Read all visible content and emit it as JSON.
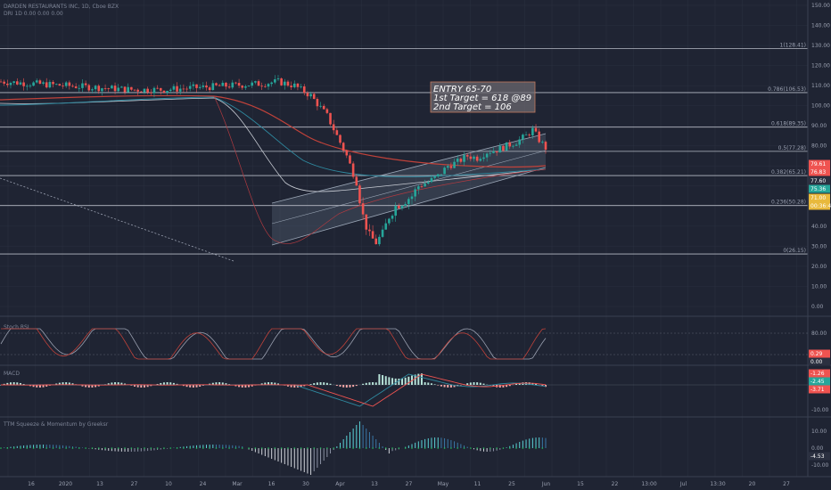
{
  "header": {
    "title": "DARDEN RESTAURANTS INC, 1D, Cboe BZX",
    "subtitle": "DRI 1D 0.00 0.00 0.00"
  },
  "annotation": {
    "line1": "ENTRY 65-70",
    "line2": "1st Target = 618 @89",
    "line3": "2nd Target = 106"
  },
  "fib_levels": [
    {
      "label": "1(128.41)",
      "value": 128.41
    },
    {
      "label": "0.786(106.53)",
      "value": 106.53
    },
    {
      "label": "0.618(89.35)",
      "value": 89.35
    },
    {
      "label": "0.5(77.28)",
      "value": 77.28
    },
    {
      "label": "0.382(65.21)",
      "value": 65.21
    },
    {
      "label": "0.236(50.28)",
      "value": 50.28
    },
    {
      "label": "0(26.15)",
      "value": 26.15
    }
  ],
  "price_axis": {
    "ticks": [
      "150.00",
      "140.00",
      "130.00",
      "120.00",
      "110.00",
      "100.00",
      "90.00",
      "80.00",
      "70.00",
      "60.00",
      "50.00",
      "40.00",
      "30.00",
      "20.00",
      "10.00",
      "0.00"
    ],
    "tags": [
      {
        "text": "79.61",
        "color": "#ef5350"
      },
      {
        "text": "76.83",
        "color": "#ef5350"
      },
      {
        "text": "77.60",
        "color": "#2b3040"
      },
      {
        "text": "75.36",
        "color": "#26a69a"
      },
      {
        "text": "71.00",
        "color": "#e8b93c"
      },
      {
        "text": "00:36:45",
        "color": "#e8b93c"
      }
    ]
  },
  "stoch_panel": {
    "title": "Stoch RSI",
    "ticks": [
      "80.00",
      "20.00"
    ],
    "tags": [
      {
        "text": "0.29",
        "color": "#ef5350"
      },
      {
        "text": "0.00",
        "color": "#2b3040"
      }
    ]
  },
  "macd_panel": {
    "title": "MACD",
    "ticks": [
      "10.00",
      "-10.00"
    ],
    "tags": [
      {
        "text": "-1.26",
        "color": "#ef5350"
      },
      {
        "text": "-2.45",
        "color": "#26a69a"
      },
      {
        "text": "-3.71",
        "color": "#ef5350"
      }
    ]
  },
  "ttm_panel": {
    "title": "TTM Squeeze & Momentum by Greeksr",
    "ticks": [
      "10.00",
      "0.00",
      "-10.00"
    ],
    "tags": [
      {
        "text": "-4.53",
        "color": "#2b3040"
      }
    ]
  },
  "time_axis": [
    "16",
    "2020",
    "13",
    "27",
    "10",
    "24",
    "Mar",
    "16",
    "30",
    "Apr",
    "13",
    "27",
    "May",
    "11",
    "25",
    "Jun",
    "15",
    "22",
    "13:00",
    "Jul",
    "13:30",
    "20",
    "27"
  ],
  "colors": {
    "background": "#1f2433",
    "grid": "#2a3040",
    "fib_line": "#b6bac4",
    "up": "#26a69a",
    "down": "#ef5350",
    "ma_red": "#c0423a",
    "ma_white": "#c8ccd4",
    "ma_teal": "#2f8aa0"
  },
  "chart_data": {
    "type": "candlestick",
    "title": "DARDEN RESTAURANTS INC, 1D, Cboe BZX",
    "ylim": [
      0,
      150
    ],
    "close_path": [
      [
        0,
        112
      ],
      [
        10,
        111
      ],
      [
        20,
        110
      ],
      [
        30,
        109
      ],
      [
        40,
        108
      ],
      [
        50,
        108
      ],
      [
        60,
        109
      ],
      [
        70,
        110
      ],
      [
        80,
        111
      ],
      [
        85,
        112
      ],
      [
        90,
        110
      ],
      [
        95,
        105
      ],
      [
        100,
        95
      ],
      [
        103,
        85
      ],
      [
        106,
        75
      ],
      [
        109,
        62
      ],
      [
        111,
        45
      ],
      [
        113,
        35
      ],
      [
        115,
        32
      ],
      [
        117,
        36
      ],
      [
        119,
        45
      ],
      [
        121,
        50
      ],
      [
        123,
        52
      ],
      [
        126,
        55
      ],
      [
        128,
        60
      ],
      [
        131,
        62
      ],
      [
        134,
        65
      ],
      [
        137,
        70
      ],
      [
        140,
        72
      ],
      [
        143,
        75
      ],
      [
        146,
        74
      ],
      [
        149,
        77
      ],
      [
        152,
        78
      ],
      [
        155,
        80
      ],
      [
        158,
        82
      ],
      [
        161,
        85
      ],
      [
        163,
        88
      ],
      [
        165,
        83
      ],
      [
        167,
        79
      ]
    ]
  }
}
